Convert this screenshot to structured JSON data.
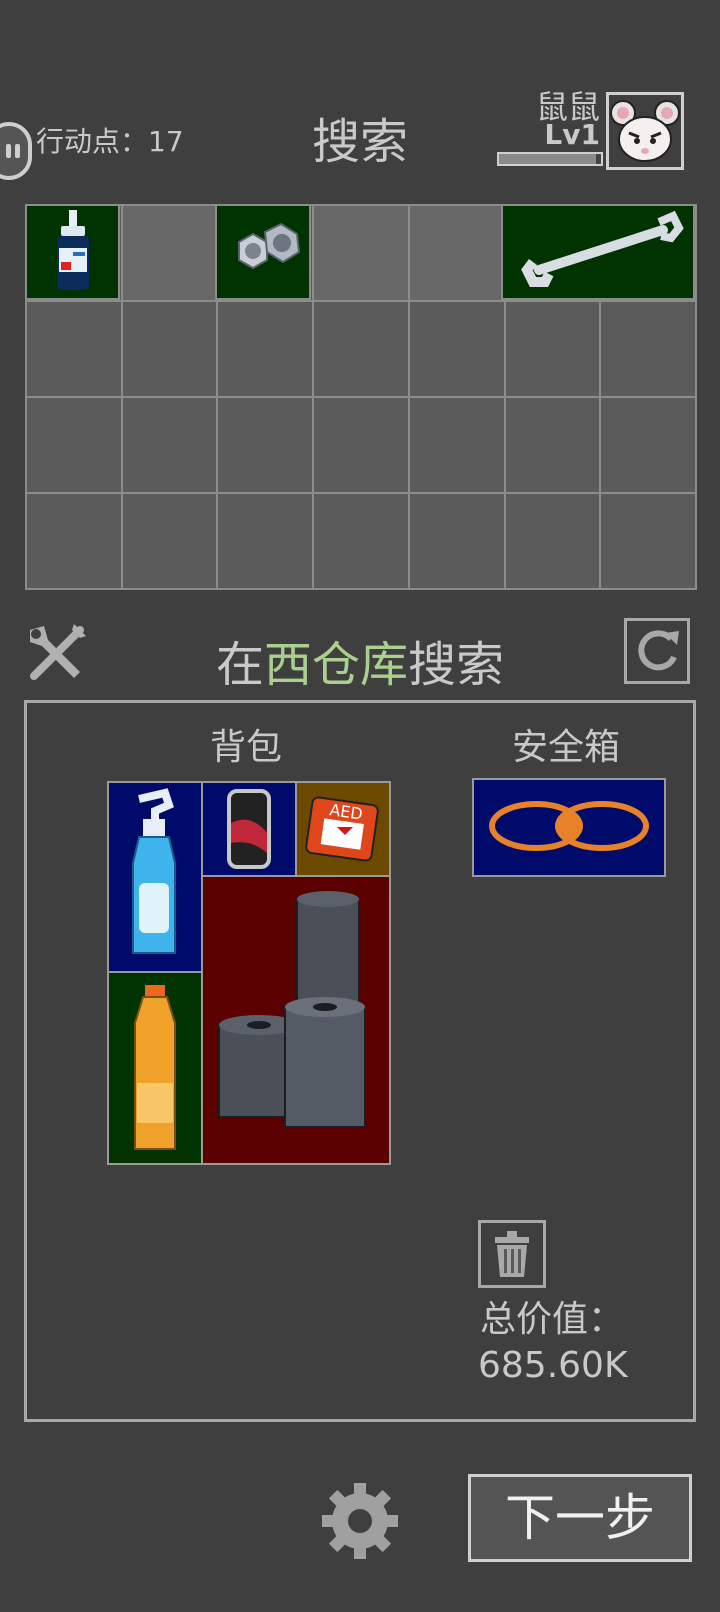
{
  "header": {
    "action_points_label": "行动点：17",
    "title": "搜索",
    "player_name": "鼠鼠",
    "player_level": "Lv1",
    "xp_progress": 0.95
  },
  "loot_items": [
    "glue-bottle-icon",
    "hex-nuts-icon",
    "wrench-icon"
  ],
  "search_bar": {
    "prefix": "在",
    "location": "西仓库",
    "suffix": "搜索"
  },
  "inventory": {
    "backpack_label": "背包",
    "safe_label": "安全箱",
    "backpack_items": [
      "spray-bottle-icon",
      "energy-can-icon",
      "aed-kit-icon",
      "water-bottle-icon",
      "pipe-rolls-icon"
    ],
    "safe_items": [
      "rope-coil-icon"
    ],
    "total_label": "总价值：",
    "total_value": "685.60K"
  },
  "footer": {
    "next_label": "下一步"
  },
  "colors": {
    "background": "#3f3f3f",
    "location_highlight": "#a9d08e",
    "loot_item_bg": "#003300",
    "item_blue": "#000a6a",
    "item_red": "#5a0000",
    "item_gold": "#6b4a00"
  }
}
